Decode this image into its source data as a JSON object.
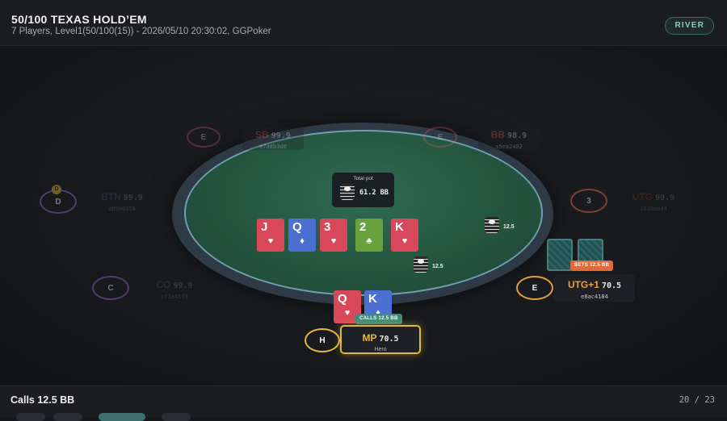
{
  "header": {
    "title": "50/100 TEXAS HOLD’EM",
    "subtitle": "7 Players, Level1(50/100(15)) - 2026/05/10 20:30:02, GGPoker",
    "street": "RIVER"
  },
  "pot": {
    "label": "Total pot",
    "value": "61.2 BB",
    "icon": "chip-stack-icon"
  },
  "board": [
    {
      "rank": "J",
      "suit": "♥",
      "color": "#d8485a"
    },
    {
      "rank": "Q",
      "suit": "♦",
      "color": "#4c6fd4"
    },
    {
      "rank": "3",
      "suit": "♥",
      "color": "#d8485a"
    },
    {
      "rank": "2",
      "suit": "♣",
      "color": "#6aa23e"
    },
    {
      "rank": "K",
      "suit": "♥",
      "color": "#d8485a"
    }
  ],
  "bets": {
    "utg1": "12.5",
    "hero": "12.5"
  },
  "seats": {
    "sb": {
      "badge": "E",
      "name": "SB",
      "stack": "99.9",
      "id": "e7a8b3d0"
    },
    "bb": {
      "badge": "E",
      "name": "BB",
      "stack": "98.9",
      "id": "a9ea2402"
    },
    "btn": {
      "badge": "D",
      "dealer": "D",
      "name": "BTN",
      "stack": "99.9",
      "id": "d09a0058"
    },
    "utg": {
      "badge": "3",
      "name": "UTG",
      "stack": "99.9",
      "id": "3610bbd4"
    },
    "co": {
      "badge": "C",
      "name": "CO",
      "stack": "99.9",
      "id": "cf1a41f3"
    },
    "utg1": {
      "badge": "E",
      "name": "UTG+1",
      "stack": "70.5",
      "id": "e8ac4184",
      "action": "BETS 12.5 BB"
    },
    "hero": {
      "badge": "H",
      "name": "MP",
      "stack": "70.5",
      "id": "Hero",
      "action": "CALLS 12.5 BB"
    }
  },
  "hero_cards": [
    {
      "rank": "Q",
      "suit": "♥",
      "color": "#d8485a"
    },
    {
      "rank": "K",
      "suit": "♦",
      "color": "#4c6fd4"
    }
  ],
  "colors": {
    "felt": "#24553f",
    "rim": "#2e3a45",
    "hero_highlight": "#e0b83a",
    "bet_tag": "#e06a3a",
    "call_tag": "#3d8c7c"
  },
  "footer": {
    "action": "Calls 12.5 BB",
    "step": "20 / 23"
  }
}
